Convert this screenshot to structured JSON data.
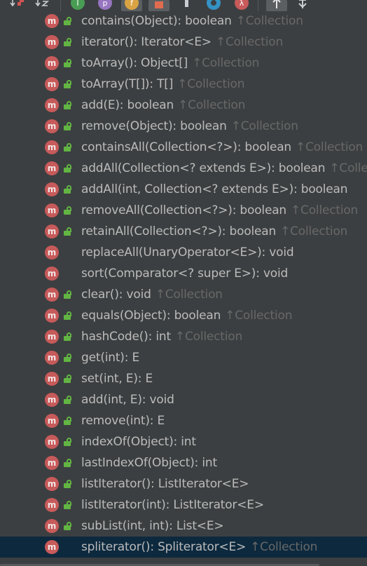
{
  "toolbar": {
    "items": [
      {
        "name": "sort-visibility-icon",
        "glyph": "↓a"
      },
      {
        "name": "sort-alphabetically-icon",
        "glyph": "↓z"
      },
      {
        "name": "show-inherited-icon",
        "glyph": "I"
      },
      {
        "name": "show-properties-icon",
        "glyph": "p"
      },
      {
        "name": "show-fields-icon",
        "glyph": "f"
      },
      {
        "name": "show-non-public-icon",
        "glyph": "🔒"
      },
      {
        "name": "show-lambdas-icon",
        "glyph": "▮"
      },
      {
        "name": "show-anonymous-icon",
        "glyph": "o"
      },
      {
        "name": "show-lambda-icon",
        "glyph": "λ"
      },
      {
        "name": "autoscroll-to-source-icon",
        "glyph": "↑"
      },
      {
        "name": "autoscroll-from-source-icon",
        "glyph": "↕"
      }
    ]
  },
  "method_icon_letter": "m",
  "inherited_arrow": "↑",
  "colors": {
    "method": "#c75a5a",
    "lock": "#62b543",
    "text": "#bbbbbb",
    "inherited": "#686868",
    "selected": "#0d293e"
  },
  "methods": [
    {
      "sig": "contains(Object): boolean",
      "inherited": "Collection",
      "locked": true
    },
    {
      "sig": "iterator(): Iterator<E>",
      "inherited": "Collection",
      "locked": true
    },
    {
      "sig": "toArray(): Object[]",
      "inherited": "Collection",
      "locked": true
    },
    {
      "sig": "toArray(T[]): T[]",
      "inherited": "Collection",
      "locked": true
    },
    {
      "sig": "add(E): boolean",
      "inherited": "Collection",
      "locked": true
    },
    {
      "sig": "remove(Object): boolean",
      "inherited": "Collection",
      "locked": true
    },
    {
      "sig": "containsAll(Collection<?>): boolean",
      "inherited": "Collection",
      "locked": true
    },
    {
      "sig": "addAll(Collection<? extends E>): boolean",
      "inherited": "Colle",
      "locked": true
    },
    {
      "sig": "addAll(int, Collection<? extends E>): boolean",
      "inherited": "",
      "locked": true
    },
    {
      "sig": "removeAll(Collection<?>): boolean",
      "inherited": "Collection",
      "locked": true
    },
    {
      "sig": "retainAll(Collection<?>): boolean",
      "inherited": "Collection",
      "locked": true
    },
    {
      "sig": "replaceAll(UnaryOperator<E>): void",
      "inherited": "",
      "locked": false
    },
    {
      "sig": "sort(Comparator<? super E>): void",
      "inherited": "",
      "locked": false
    },
    {
      "sig": "clear(): void",
      "inherited": "Collection",
      "locked": true
    },
    {
      "sig": "equals(Object): boolean",
      "inherited": "Collection",
      "locked": true
    },
    {
      "sig": "hashCode(): int",
      "inherited": "Collection",
      "locked": true
    },
    {
      "sig": "get(int): E",
      "inherited": "",
      "locked": true
    },
    {
      "sig": "set(int, E): E",
      "inherited": "",
      "locked": true
    },
    {
      "sig": "add(int, E): void",
      "inherited": "",
      "locked": true
    },
    {
      "sig": "remove(int): E",
      "inherited": "",
      "locked": true
    },
    {
      "sig": "indexOf(Object): int",
      "inherited": "",
      "locked": true
    },
    {
      "sig": "lastIndexOf(Object): int",
      "inherited": "",
      "locked": true
    },
    {
      "sig": "listIterator(): ListIterator<E>",
      "inherited": "",
      "locked": true
    },
    {
      "sig": "listIterator(int): ListIterator<E>",
      "inherited": "",
      "locked": true
    },
    {
      "sig": "subList(int, int): List<E>",
      "inherited": "",
      "locked": true
    },
    {
      "sig": "spliterator(): Spliterator<E>",
      "inherited": "Collection",
      "locked": false,
      "selected": true
    }
  ]
}
